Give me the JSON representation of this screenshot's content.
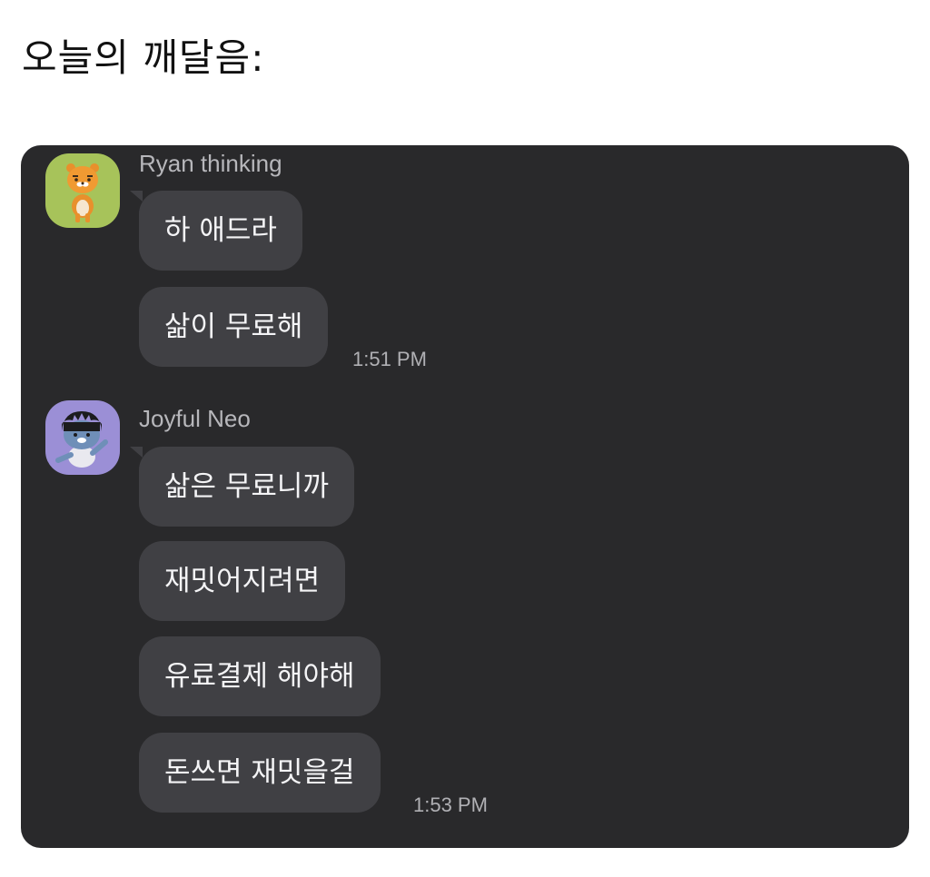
{
  "post": {
    "title": "오늘의 깨달음:"
  },
  "chat": {
    "groups": [
      {
        "sender": "Ryan thinking",
        "avatar": "ryan-character-icon",
        "avatar_bg": "#a7c35a",
        "messages": [
          "하 애드라",
          "삶이 무료해"
        ],
        "time": "1:51 PM"
      },
      {
        "sender": "Joyful Neo",
        "avatar": "neo-character-icon",
        "avatar_bg": "#9b8fd6",
        "messages": [
          "삶은 무료니까",
          "재밋어지려면",
          "유료결제 해야해",
          "돈쓰면 재밋을걸"
        ],
        "time": "1:53 PM"
      }
    ]
  },
  "colors": {
    "panel_bg": "#29292b",
    "bubble_bg": "#404044",
    "bubble_text": "#f4f4f6",
    "meta_text": "#b0b0b4"
  }
}
